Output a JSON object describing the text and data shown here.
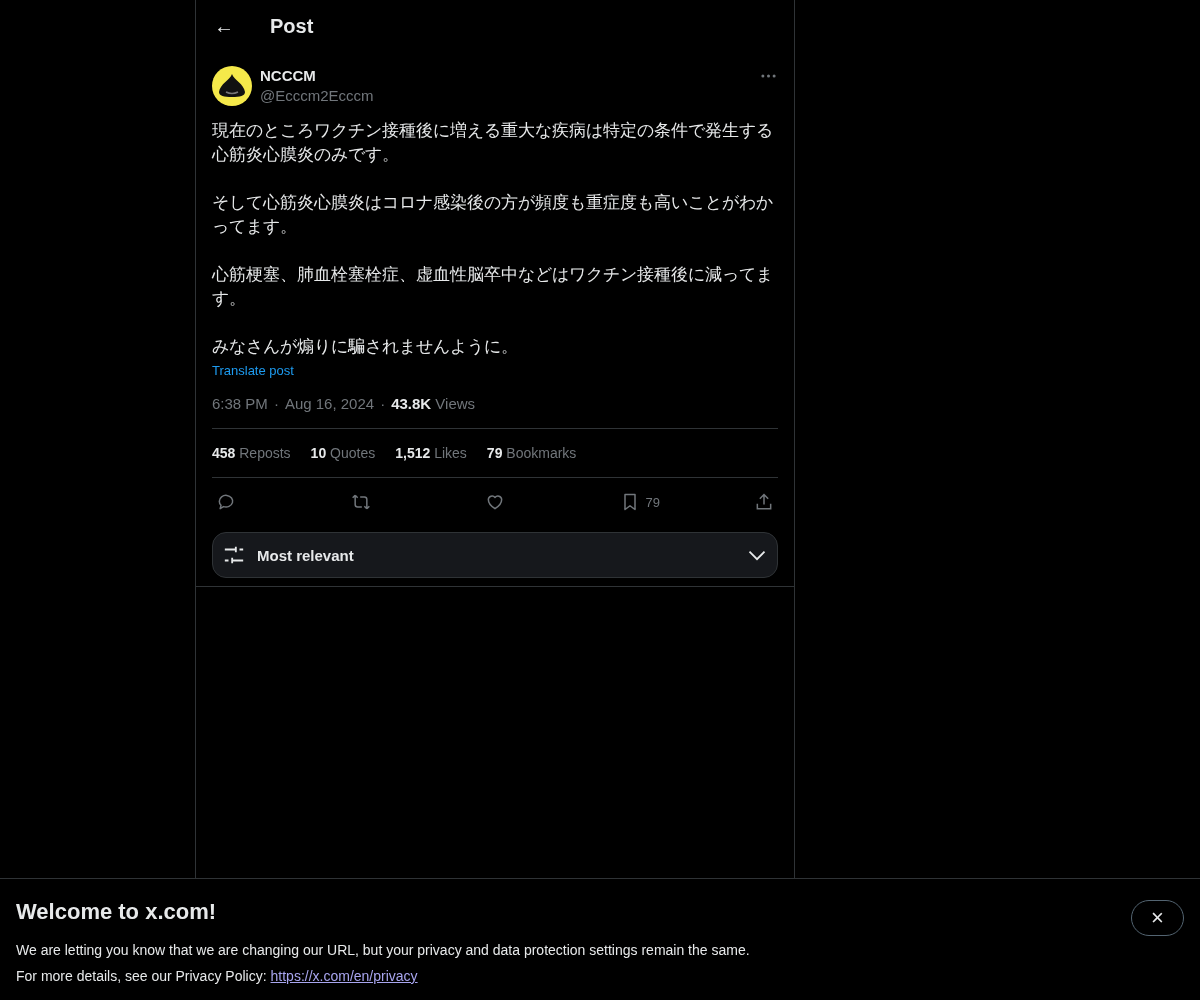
{
  "header": {
    "back": "←",
    "title": "Post"
  },
  "post": {
    "author": {
      "name": "NCCCM",
      "handle": "@Ecccm2Ecccm"
    },
    "paragraphs": [
      "現在のところワクチン接種後に増える重大な疾病は特定の条件で発生する心筋炎心膜炎のみです。",
      "そして心筋炎心膜炎はコロナ感染後の方が頻度も重症度も高いことがわかってます。",
      "心筋梗塞、肺血栓塞栓症、虚血性脳卒中などはワクチン接種後に減ってます。",
      "みなさんが煽りに騙されませんように。"
    ],
    "translate": "Translate post",
    "time": "6:38 PM",
    "sep1": "·",
    "date": "Aug 16, 2024",
    "sep2": "·",
    "views": "**43.8K** Views",
    "stats": [
      "**458** Reposts",
      "**10** Quotes",
      "**1,512** Likes",
      "**79** Bookmarks"
    ],
    "actions": [
      {
        "kind": "reply"
      },
      {
        "kind": "repost"
      },
      {
        "kind": "like"
      },
      {
        "kind": "bookmark",
        "count": "79"
      },
      {
        "kind": "share"
      }
    ]
  },
  "sort": {
    "label": "Most relevant"
  },
  "banner": {
    "title": "Welcome to x.com!",
    "line1": "We are letting you know that we are changing our URL, but your privacy and data protection settings remain the same.",
    "line2": "For more details, see our Privacy Policy:",
    "link": "https://x.com/en/privacy",
    "close": "×"
  }
}
